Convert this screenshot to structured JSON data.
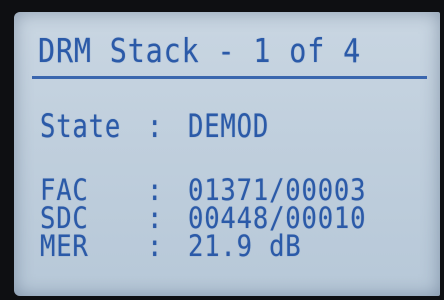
{
  "screen": {
    "title": "DRM Stack - 1 of 4",
    "rows": [
      {
        "label": "State",
        "separator": ":",
        "value": "DEMOD"
      },
      {
        "label": "FAC",
        "separator": ":",
        "value": "01371/00003"
      },
      {
        "label": "SDC",
        "separator": ":",
        "value": "00448/00010"
      },
      {
        "label": "MER",
        "separator": ":",
        "value": "21.9 dB"
      }
    ]
  },
  "colors": {
    "lcd_background": "#c4d2e0",
    "lcd_text": "#2b5aa8",
    "bezel": "#0e0f12"
  }
}
